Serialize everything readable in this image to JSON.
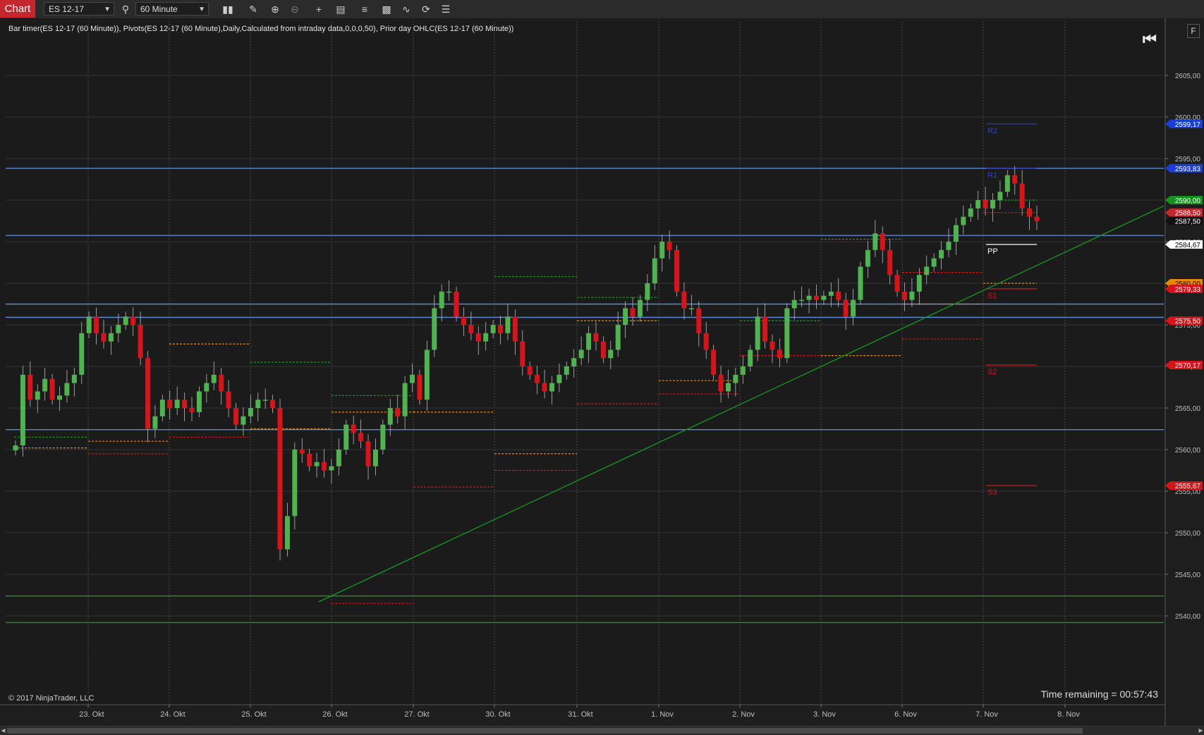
{
  "toolbar": {
    "chart_tab": "Chart",
    "instrument": "ES 12-17",
    "interval": "60 Minute",
    "icons": [
      "search-icon",
      "bar-type-icon",
      "draw-pencil-icon",
      "zoom-in-icon",
      "zoom-out-icon",
      "crosshair-icon",
      "data-box-icon",
      "indicators-icon",
      "strategies-icon",
      "chart-trader-icon",
      "refresh-icon",
      "properties-list-icon"
    ]
  },
  "chart": {
    "indicator_label": "Bar timer(ES 12-17 (60 Minute)), Pivots(ES 12-17 (60 Minute),Daily,Calculated from intraday data,0,0,0,50), Prior day OHLC(ES 12-17 (60 Minute))",
    "copyright": "© 2017 NinjaTrader, LLC",
    "time_remaining": "Time remaining = 00:57:43",
    "f_button": "F",
    "nav_end_icon": "skip-to-end-icon"
  },
  "chart_data": {
    "type": "candlestick",
    "instrument": "ES 12-17",
    "interval": "60 Minute",
    "x_tick_labels": [
      "23. Okt",
      "24. Okt",
      "25. Okt",
      "26. Okt",
      "27. Okt",
      "30. Okt",
      "31. Okt",
      "1. Nov",
      "2. Nov",
      "3. Nov",
      "6. Nov",
      "7. Nov",
      "8. Nov"
    ],
    "y_tick_labels": [
      "2605,00",
      "2600,00",
      "2595,00",
      "2590,00",
      "2585,00",
      "2580,00",
      "2575,00",
      "2570,00",
      "2565,00",
      "2560,00",
      "2555,00",
      "2550,00",
      "2545,00",
      "2540,00"
    ],
    "ylim": [
      2538,
      2611
    ],
    "closes": [
      2560.5,
      2569,
      2566,
      2567,
      2568.5,
      2566,
      2566.5,
      2568,
      2569,
      2574,
      2576,
      2574,
      2573,
      2574,
      2575,
      2576,
      2575,
      2571,
      2562.5,
      2564,
      2566,
      2565,
      2566,
      2565,
      2564.5,
      2567,
      2568,
      2569,
      2567,
      2565,
      2563,
      2564,
      2565,
      2566,
      2566,
      2565,
      2548,
      2552,
      2560,
      2559.5,
      2558,
      2558.5,
      2557.5,
      2558,
      2560,
      2563,
      2562,
      2561,
      2558,
      2560,
      2563,
      2565,
      2564,
      2568,
      2569,
      2566,
      2572,
      2577,
      2579,
      2579,
      2576,
      2575,
      2574,
      2573,
      2574,
      2575,
      2574,
      2576,
      2573,
      2570,
      2569,
      2568,
      2567,
      2568,
      2569,
      2570,
      2571,
      2572,
      2574,
      2573,
      2571,
      2572,
      2575,
      2577,
      2576,
      2578,
      2580,
      2583,
      2585,
      2584,
      2579,
      2577,
      2577,
      2574,
      2572,
      2569,
      2567,
      2568,
      2569,
      2570,
      2572,
      2576,
      2573,
      2572,
      2571,
      2577,
      2578,
      2578,
      2578.5,
      2578,
      2578.5,
      2579,
      2578,
      2576,
      2578,
      2582,
      2584,
      2586,
      2584,
      2581,
      2579,
      2578,
      2579,
      2581,
      2582,
      2583,
      2584,
      2585,
      2587,
      2588,
      2589,
      2590,
      2589,
      2590,
      2591,
      2593,
      2592,
      2589,
      2588,
      2587.5
    ],
    "last_price": "2587,50",
    "price_markers": [
      {
        "label": "2599,17",
        "value": 2599.17,
        "bg": "#1a3fd4",
        "fg": "#ffffff"
      },
      {
        "label": "2593,83",
        "value": 2593.83,
        "bg": "#1a3fd4",
        "fg": "#ffffff"
      },
      {
        "label": "2590,00",
        "value": 2590.0,
        "bg": "#13921e",
        "fg": "#ffffff"
      },
      {
        "label": "2588,50",
        "value": 2588.5,
        "bg": "#c4272d",
        "fg": "#ffffff"
      },
      {
        "label": "2587,50",
        "value": 2587.5,
        "bg": "#111111",
        "fg": "#ffffff"
      },
      {
        "label": "2584,67",
        "value": 2584.67,
        "bg": "#ffffff",
        "fg": "#000000"
      },
      {
        "label": "2580,00",
        "value": 2580.0,
        "bg": "#e68a00",
        "fg": "#000000"
      },
      {
        "label": "2579,33",
        "value": 2579.33,
        "bg": "#d8141b",
        "fg": "#ffffff"
      },
      {
        "label": "2575,50",
        "value": 2575.5,
        "bg": "#d8141b",
        "fg": "#ffffff"
      },
      {
        "label": "2570,17",
        "value": 2570.17,
        "bg": "#d8141b",
        "fg": "#ffffff"
      },
      {
        "label": "2555,67",
        "value": 2555.67,
        "bg": "#d8141b",
        "fg": "#ffffff"
      }
    ],
    "pivot_labels": [
      {
        "label": "R2",
        "value": 2599.17,
        "color": "#2a3fd0"
      },
      {
        "label": "R1",
        "value": 2593.83,
        "color": "#2a3fd0"
      },
      {
        "label": "PP",
        "value": 2584.67,
        "color": "#ffffff"
      },
      {
        "label": "S1",
        "value": 2579.33,
        "color": "#d8141b"
      },
      {
        "label": "S2",
        "value": 2570.17,
        "color": "#d8141b"
      },
      {
        "label": "S3",
        "value": 2555.67,
        "color": "#d8141b"
      }
    ],
    "horizontal_lines": [
      {
        "value": 2593.83,
        "color": "#5b86d6"
      },
      {
        "value": 2585.75,
        "color": "#5b86d6"
      },
      {
        "value": 2577.5,
        "color": "#5b86d6"
      },
      {
        "value": 2575.9,
        "color": "#5b86d6"
      },
      {
        "value": 2562.4,
        "color": "#5b86d6"
      },
      {
        "value": 2542.4,
        "color": "#139e1e"
      },
      {
        "value": 2539.2,
        "color": "#139e1e"
      }
    ],
    "trendline": {
      "from": {
        "x": "26. Okt",
        "y": 2541.7
      },
      "to": {
        "x": "8. Nov",
        "y": 2589.3
      },
      "color": "#13921e"
    },
    "colors": {
      "up": "#4fb34f",
      "down": "#d8141b",
      "background": "#1b1b1b",
      "grid": "#3c3c3c",
      "prior_open": "#e68a00",
      "prior_high": "#139e1e",
      "prior_low": "#d8141b"
    }
  }
}
